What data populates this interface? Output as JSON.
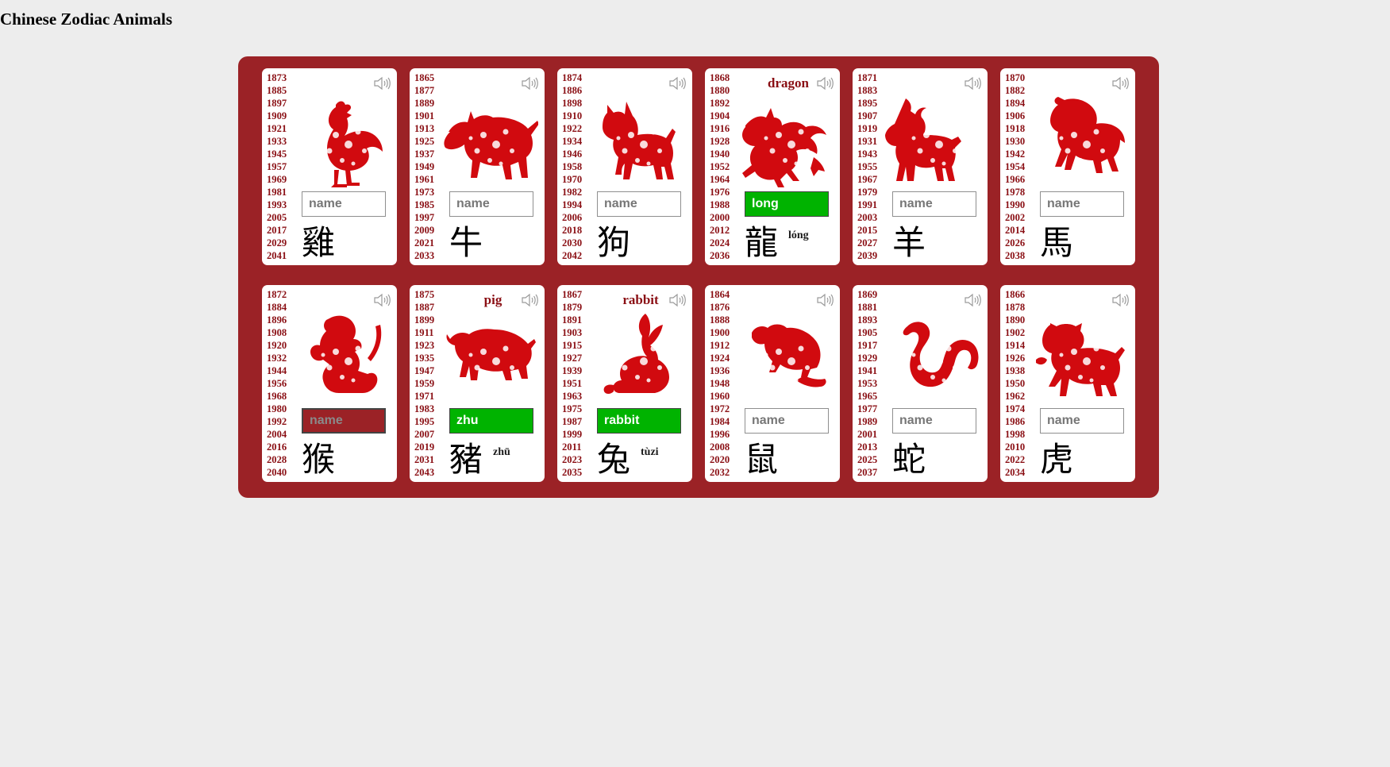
{
  "page": {
    "title": "Chinese Zodiac Animals"
  },
  "input_placeholder": "name",
  "colors": {
    "board": "#9b2226",
    "year_text": "#8a0f14",
    "correct": "#00b300",
    "animal_fill": "#d10a0f"
  },
  "cards": [
    {
      "id": "rooster",
      "icon": "rooster-icon",
      "hanzi": "雞",
      "label": "",
      "pinyin": "",
      "value": "",
      "status": "",
      "years": [
        "1873",
        "1885",
        "1897",
        "1909",
        "1921",
        "1933",
        "1945",
        "1957",
        "1969",
        "1981",
        "1993",
        "2005",
        "2017",
        "2029",
        "2041"
      ]
    },
    {
      "id": "ox",
      "icon": "ox-icon",
      "hanzi": "牛",
      "label": "",
      "pinyin": "",
      "value": "",
      "status": "",
      "years": [
        "1865",
        "1877",
        "1889",
        "1901",
        "1913",
        "1925",
        "1937",
        "1949",
        "1961",
        "1973",
        "1985",
        "1997",
        "2009",
        "2021",
        "2033"
      ]
    },
    {
      "id": "dog",
      "icon": "dog-icon",
      "hanzi": "狗",
      "label": "",
      "pinyin": "",
      "value": "",
      "status": "",
      "years": [
        "1874",
        "1886",
        "1898",
        "1910",
        "1922",
        "1934",
        "1946",
        "1958",
        "1970",
        "1982",
        "1994",
        "2006",
        "2018",
        "2030",
        "2042"
      ]
    },
    {
      "id": "dragon",
      "icon": "dragon-icon",
      "hanzi": "龍",
      "label": "dragon",
      "pinyin": "lóng",
      "value": "long",
      "status": "correct",
      "years": [
        "1868",
        "1880",
        "1892",
        "1904",
        "1916",
        "1928",
        "1940",
        "1952",
        "1964",
        "1976",
        "1988",
        "2000",
        "2012",
        "2024",
        "2036"
      ]
    },
    {
      "id": "goat",
      "icon": "goat-icon",
      "hanzi": "羊",
      "label": "",
      "pinyin": "",
      "value": "",
      "status": "",
      "years": [
        "1871",
        "1883",
        "1895",
        "1907",
        "1919",
        "1931",
        "1943",
        "1955",
        "1967",
        "1979",
        "1991",
        "2003",
        "2015",
        "2027",
        "2039"
      ]
    },
    {
      "id": "horse",
      "icon": "horse-icon",
      "hanzi": "馬",
      "label": "",
      "pinyin": "",
      "value": "",
      "status": "",
      "years": [
        "1870",
        "1882",
        "1894",
        "1906",
        "1918",
        "1930",
        "1942",
        "1954",
        "1966",
        "1978",
        "1990",
        "2002",
        "2014",
        "2026",
        "2038"
      ]
    },
    {
      "id": "monkey",
      "icon": "monkey-icon",
      "hanzi": "猴",
      "label": "",
      "pinyin": "",
      "value": "",
      "status": "wrong",
      "years": [
        "1872",
        "1884",
        "1896",
        "1908",
        "1920",
        "1932",
        "1944",
        "1956",
        "1968",
        "1980",
        "1992",
        "2004",
        "2016",
        "2028",
        "2040"
      ]
    },
    {
      "id": "pig",
      "icon": "pig-icon",
      "hanzi": "豬",
      "label": "pig",
      "pinyin": "zhū",
      "value": "zhu",
      "status": "correct",
      "years": [
        "1875",
        "1887",
        "1899",
        "1911",
        "1923",
        "1935",
        "1947",
        "1959",
        "1971",
        "1983",
        "1995",
        "2007",
        "2019",
        "2031",
        "2043"
      ]
    },
    {
      "id": "rabbit",
      "icon": "rabbit-icon",
      "hanzi": "兔",
      "label": "rabbit",
      "pinyin": "tùzi",
      "value": "rabbit",
      "status": "correct",
      "years": [
        "1867",
        "1879",
        "1891",
        "1903",
        "1915",
        "1927",
        "1939",
        "1951",
        "1963",
        "1975",
        "1987",
        "1999",
        "2011",
        "2023",
        "2035"
      ]
    },
    {
      "id": "rat",
      "icon": "rat-icon",
      "hanzi": "鼠",
      "label": "",
      "pinyin": "",
      "value": "",
      "status": "",
      "years": [
        "1864",
        "1876",
        "1888",
        "1900",
        "1912",
        "1924",
        "1936",
        "1948",
        "1960",
        "1972",
        "1984",
        "1996",
        "2008",
        "2020",
        "2032"
      ]
    },
    {
      "id": "snake",
      "icon": "snake-icon",
      "hanzi": "蛇",
      "label": "",
      "pinyin": "",
      "value": "",
      "status": "",
      "years": [
        "1869",
        "1881",
        "1893",
        "1905",
        "1917",
        "1929",
        "1941",
        "1953",
        "1965",
        "1977",
        "1989",
        "2001",
        "2013",
        "2025",
        "2037"
      ]
    },
    {
      "id": "tiger",
      "icon": "tiger-icon",
      "hanzi": "虎",
      "label": "",
      "pinyin": "",
      "value": "",
      "status": "",
      "years": [
        "1866",
        "1878",
        "1890",
        "1902",
        "1914",
        "1926",
        "1938",
        "1950",
        "1962",
        "1974",
        "1986",
        "1998",
        "2010",
        "2022",
        "2034"
      ]
    }
  ]
}
